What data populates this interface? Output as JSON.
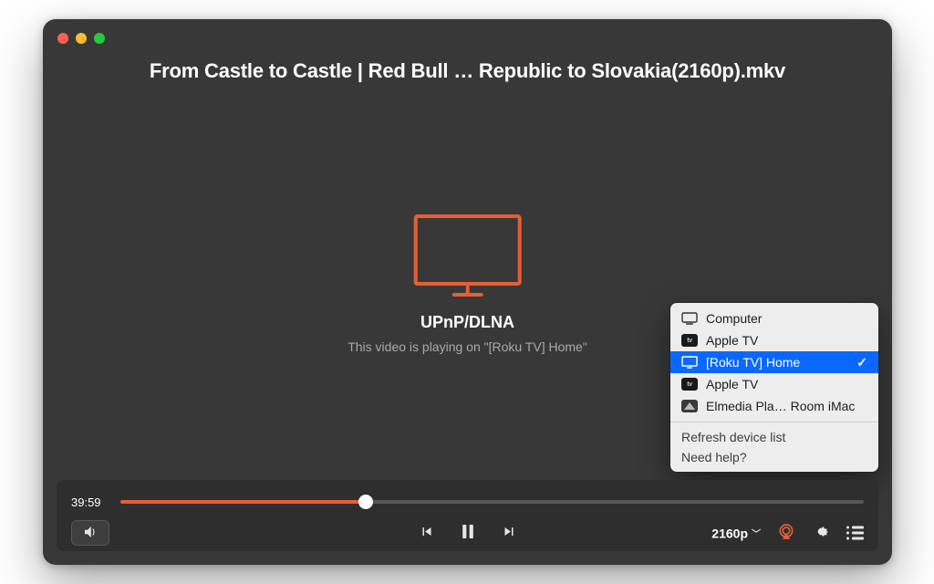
{
  "title": "From Castle to Castle | Red Bull … Republic to Slovakia(2160p).mkv",
  "cast": {
    "protocol": "UPnP/DLNA",
    "status_text": "This video is playing on \"[Roku TV] Home\""
  },
  "playback": {
    "elapsed": "39:59",
    "progress_pct": 33
  },
  "quality": {
    "label": "2160p"
  },
  "device_menu": {
    "devices": [
      {
        "icon": "computer-icon",
        "label": "Computer",
        "selected": false
      },
      {
        "icon": "apple-tv-icon",
        "label": "Apple TV",
        "selected": false
      },
      {
        "icon": "tv-icon",
        "label": "[Roku TV] Home",
        "selected": true
      },
      {
        "icon": "apple-tv-icon",
        "label": "Apple TV",
        "selected": false
      },
      {
        "icon": "elmedia-icon",
        "label": "Elmedia Pla… Room iMac",
        "selected": false
      }
    ],
    "actions": {
      "refresh": "Refresh device list",
      "help": "Need help?"
    }
  },
  "colors": {
    "accent": "#e65e35",
    "menu_highlight": "#0a68ff"
  }
}
